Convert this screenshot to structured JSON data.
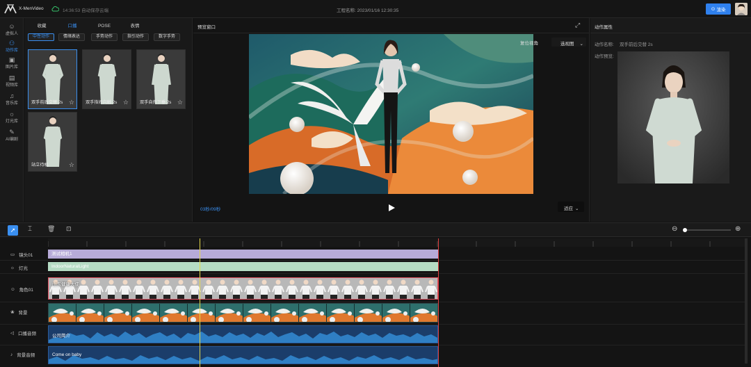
{
  "app": {
    "name": "X-MenVideo",
    "save_status": "14:36:53 自动保存云端",
    "project_label": "工程名称: 2023/01/16 12:30:35",
    "submit_label": "渲染",
    "accent": "#3a8ff0"
  },
  "rail": [
    {
      "label": "虚拟人",
      "icon": "person-icon",
      "active": false
    },
    {
      "label": "动作库",
      "icon": "motion-icon",
      "active": true
    },
    {
      "label": "图片库",
      "icon": "image-icon",
      "active": false
    },
    {
      "label": "视频库",
      "icon": "video-icon",
      "active": false
    },
    {
      "label": "音乐库",
      "icon": "music-icon",
      "active": false
    },
    {
      "label": "灯光库",
      "icon": "light-icon",
      "active": false
    },
    {
      "label": "AI编剧",
      "icon": "ai-icon",
      "active": false
    }
  ],
  "assets": {
    "tabs": [
      "收藏",
      "口播",
      "POSE",
      "表情"
    ],
    "active_tab": 1,
    "subtabs": [
      "中性动作",
      "情绪表达",
      "手势动作",
      "指引动作",
      "数字手势"
    ],
    "active_subtab": 0,
    "cards": [
      {
        "label": "双手前后交替 2s"
      },
      {
        "label": "双手指间向触 2s"
      },
      {
        "label": "双手自然下垂 2s"
      },
      {
        "label": "站立待机"
      }
    ]
  },
  "preview": {
    "title": "预览窗口",
    "reset_view": "复位视角",
    "view_select": "选视图",
    "time": "03秒/09秒",
    "fit_select": "适应"
  },
  "props": {
    "title": "动作属性",
    "name_label": "动作名称:",
    "name_value": "双手前后交替 2s",
    "preview_label": "动作预览:"
  },
  "timeline": {
    "tracks": [
      {
        "label": "镜头01",
        "icon": "camera-icon",
        "clip": "测试相机1",
        "color": "#b7abd8"
      },
      {
        "label": "灯光",
        "icon": "bulb-icon",
        "clip": "IndoorNaturalLight",
        "color": "#b5dcc4"
      },
      {
        "label": "角色01",
        "icon": "character-icon",
        "clip": "山东健康大使",
        "color": "#e8e8e8"
      },
      {
        "label": "背景",
        "icon": "background-icon",
        "clip": "",
        "color": "#3a6a6a"
      },
      {
        "label": "口播音频",
        "icon": "speaker-icon",
        "clip": "公司简介",
        "color": "#1b3d6a"
      },
      {
        "label": "背景音频",
        "icon": "music-note-icon",
        "clip": "Come on baby",
        "color": "#1b3d6a"
      }
    ]
  }
}
